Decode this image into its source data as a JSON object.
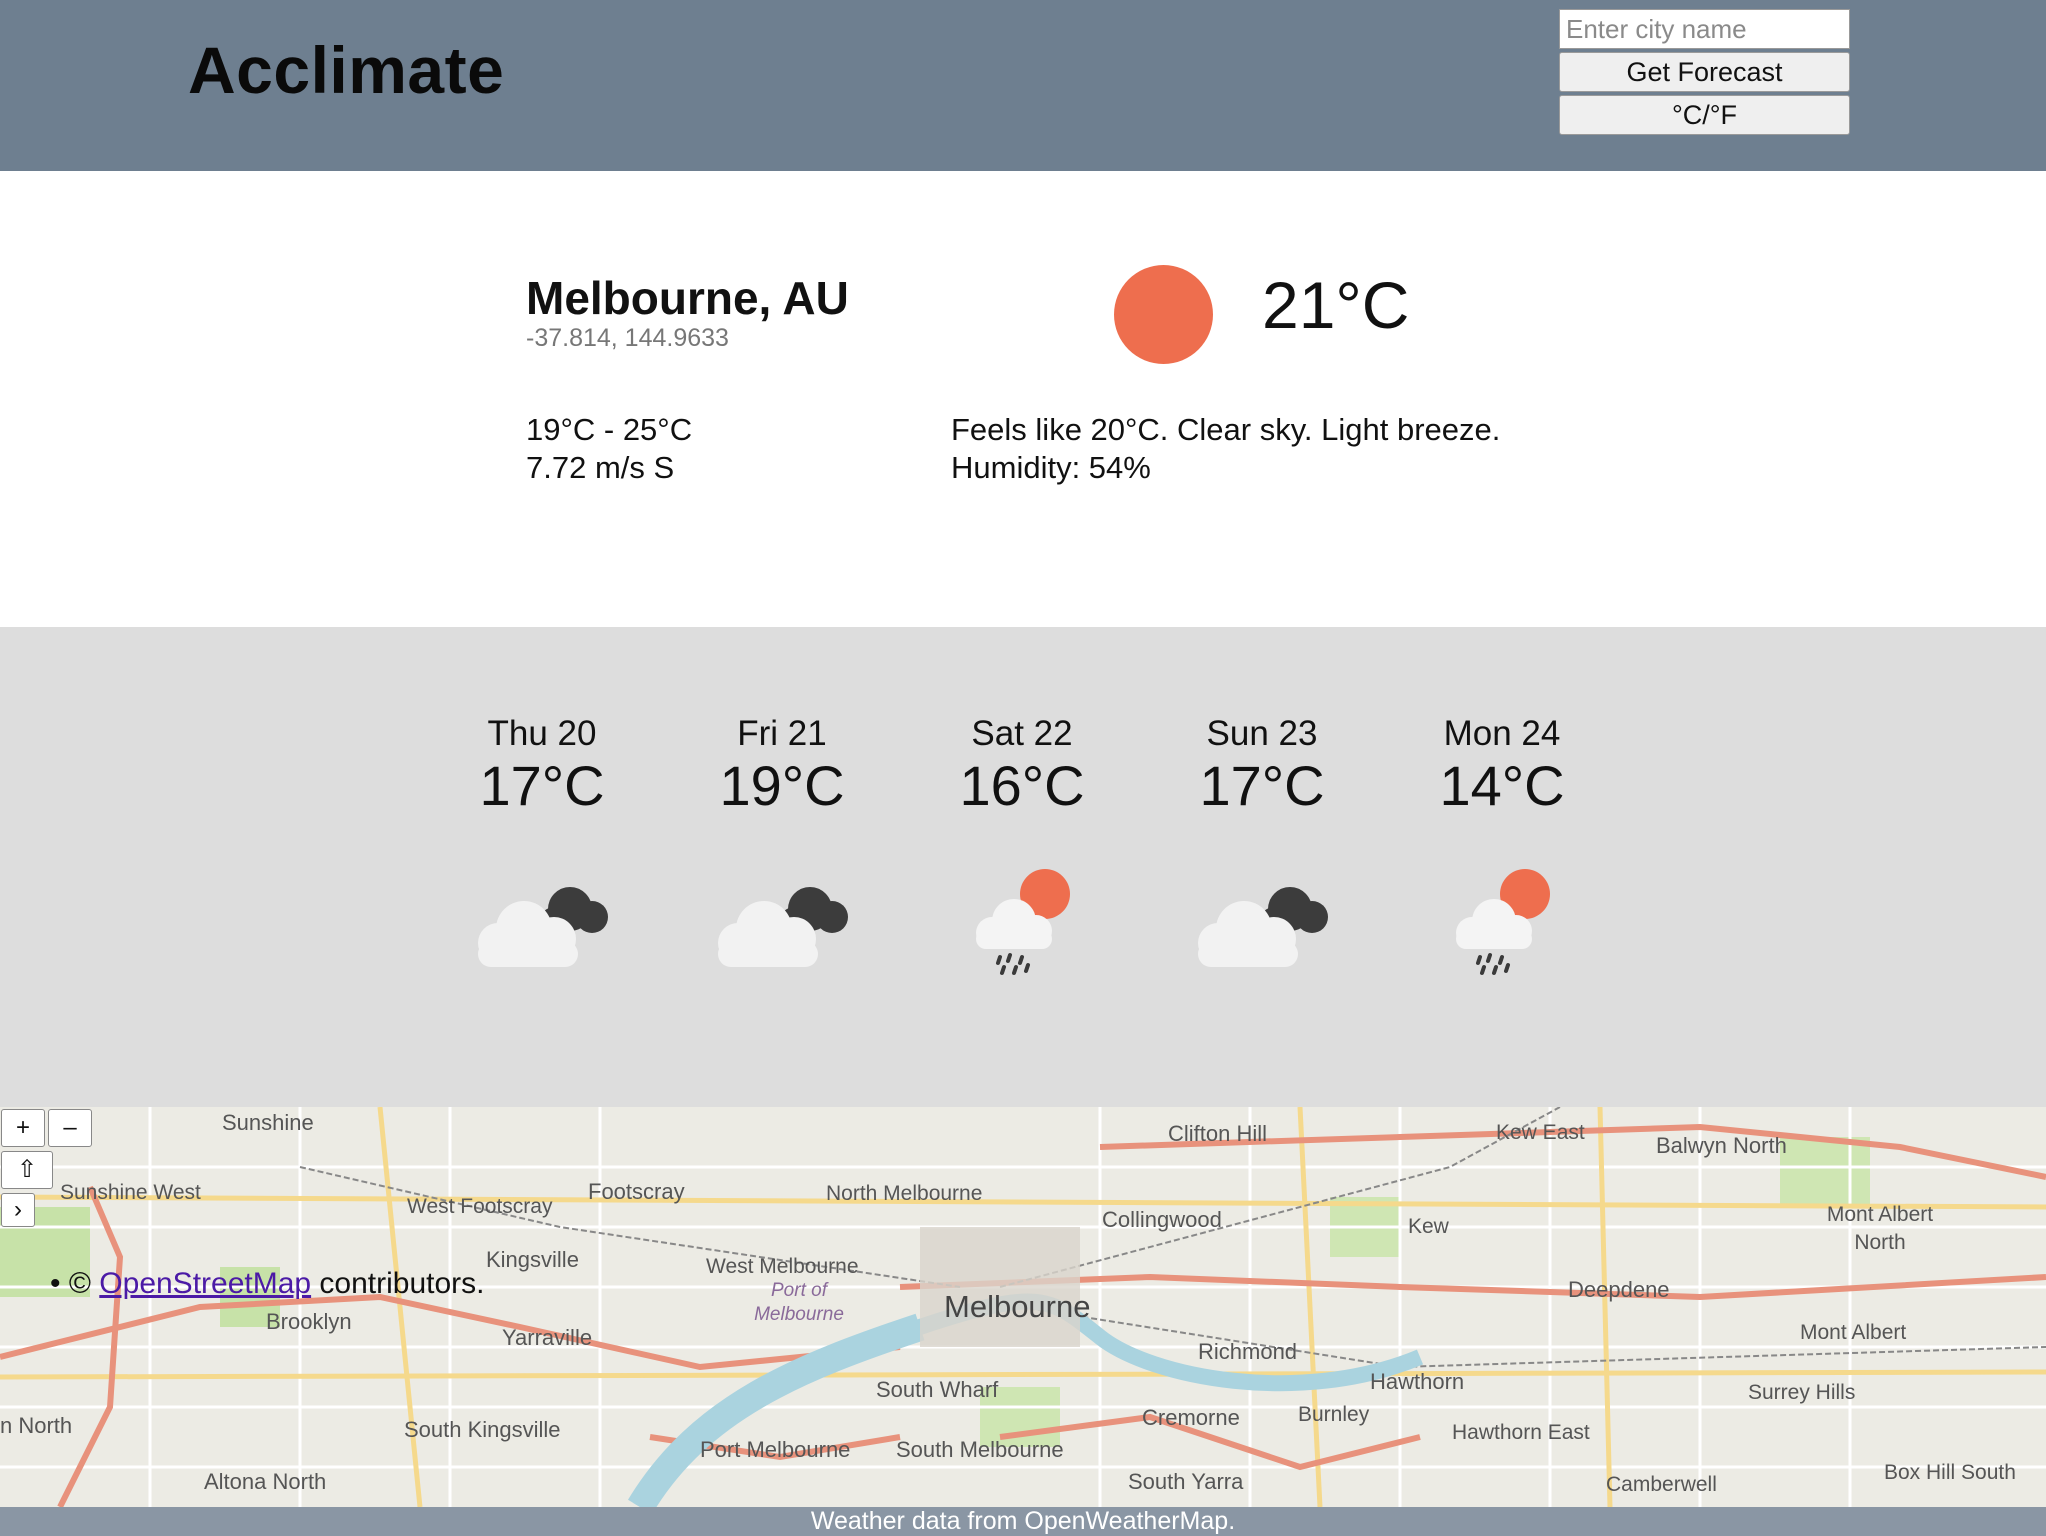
{
  "app": {
    "title": "Acclimate"
  },
  "search": {
    "placeholder": "Enter city name",
    "submit_label": "Get Forecast",
    "unit_toggle_label": "°C/°F"
  },
  "current": {
    "city": "Melbourne, AU",
    "coords": "-37.814, 144.9633",
    "temp": "21°C",
    "range": "19°C - 25°C",
    "wind": "7.72 m/s S",
    "summary": "Feels like 20°C. Clear sky. Light breeze.",
    "humidity": "Humidity: 54%",
    "icon": "sun-icon"
  },
  "forecast": [
    {
      "day": "Thu 20",
      "temp": "17°C",
      "icon": "cloud-icon"
    },
    {
      "day": "Fri 21",
      "temp": "19°C",
      "icon": "cloud-icon"
    },
    {
      "day": "Sat 22",
      "temp": "16°C",
      "icon": "rain-sun-icon"
    },
    {
      "day": "Sun 23",
      "temp": "17°C",
      "icon": "cloud-icon"
    },
    {
      "day": "Mon 24",
      "temp": "14°C",
      "icon": "rain-sun-icon"
    }
  ],
  "map": {
    "zoom_in": "+",
    "zoom_out": "–",
    "home": "⇧",
    "expand": "›",
    "attribution_prefix": "© ",
    "attribution_link": "OpenStreetMap",
    "attribution_suffix": " contributors.",
    "labels": {
      "melbourne": "Melbourne",
      "clifton_hill": "Clifton Hill",
      "kew_east": "Kew East",
      "balwyn_north": "Balwyn North",
      "sunshine": "Sunshine",
      "sunshine_west": "Sunshine West",
      "footscray": "Footscray",
      "west_footscray": "West Footscray",
      "north_melbourne": "North Melbourne",
      "collingwood": "Collingwood",
      "kew": "Kew",
      "mont_albert_north": "Mont Albert North",
      "kingsville": "Kingsville",
      "west_melbourne": "West Melbourne",
      "port_of_melbourne": "Port of Melbourne",
      "deepdene": "Deepdene",
      "brooklyn": "Brooklyn",
      "yarraville": "Yarraville",
      "richmond": "Richmond",
      "mont_albert": "Mont Albert",
      "hawthorn": "Hawthorn",
      "surrey_hills": "Surrey Hills",
      "south_wharf": "South Wharf",
      "cremorne": "Cremorne",
      "burnley": "Burnley",
      "hawthorn_east": "Hawthorn East",
      "south_kingsville": "South Kingsville",
      "port_melbourne": "Port Melbourne",
      "south_melbourne": "South Melbourne",
      "altona_north": "Altona North",
      "south_yarra": "South Yarra",
      "camberwell": "Camberwell",
      "box_hill_south": "Box Hill South",
      "north": "n North"
    }
  },
  "footer": {
    "text": "Weather data from OpenWeatherMap."
  }
}
